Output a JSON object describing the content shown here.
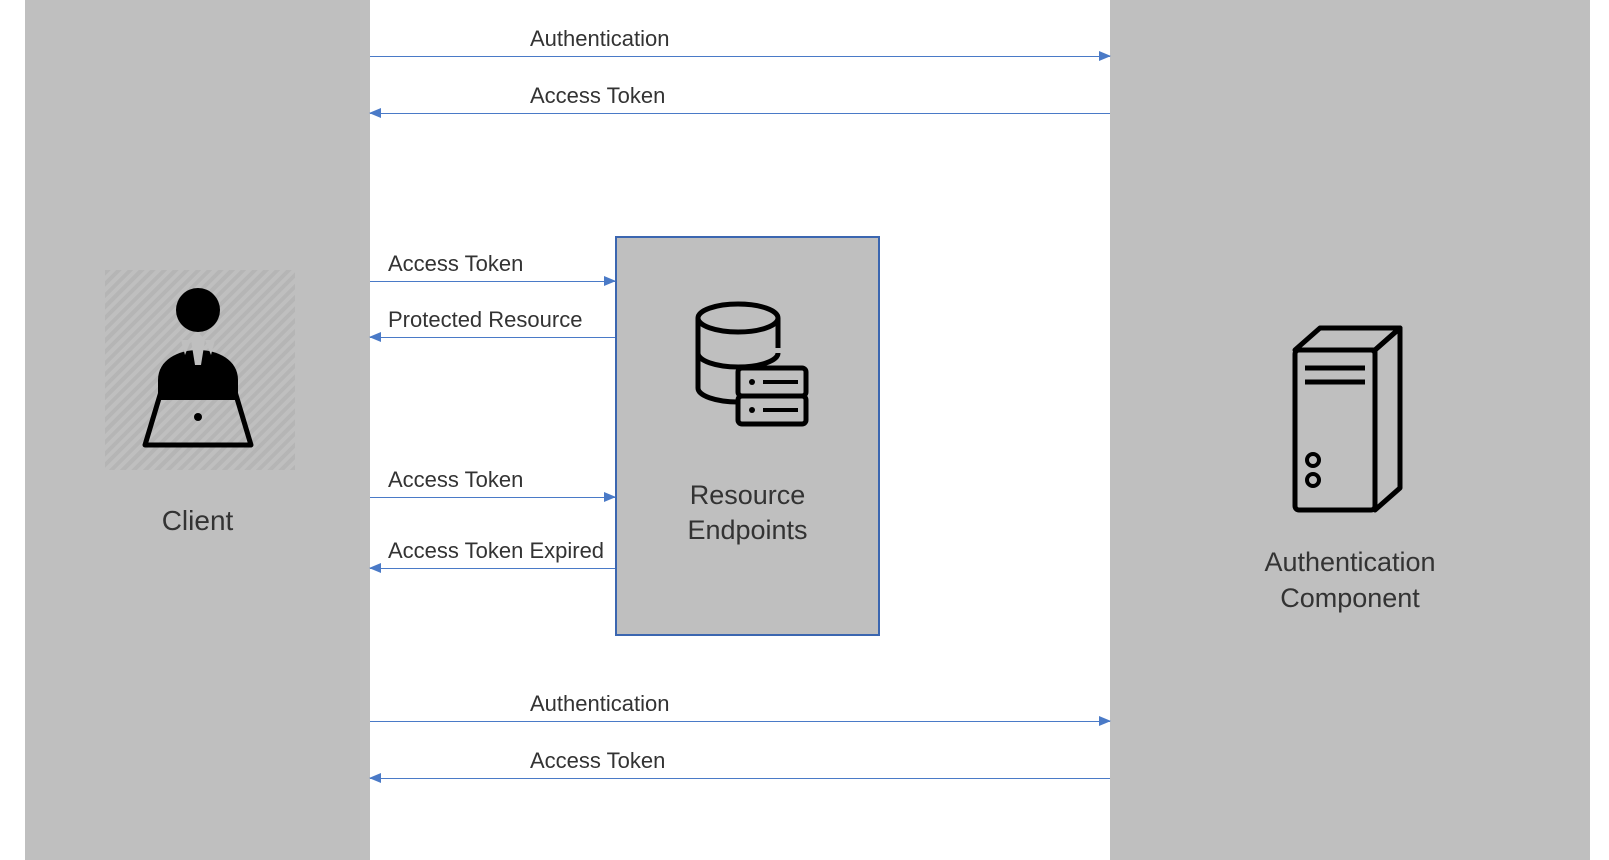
{
  "nodes": {
    "client": {
      "label": "Client"
    },
    "resource": {
      "label_line1": "Resource",
      "label_line2": "Endpoints"
    },
    "auth": {
      "label_line1": "Authentication",
      "label_line2": "Component"
    }
  },
  "arrows": {
    "a1": {
      "label": "Authentication"
    },
    "a2": {
      "label": "Access Token"
    },
    "a3": {
      "label": "Access Token"
    },
    "a4": {
      "label": "Protected Resource"
    },
    "a5": {
      "label": "Access Token"
    },
    "a6": {
      "label": "Access Token Expired"
    },
    "a7": {
      "label": "Authentication"
    },
    "a8": {
      "label": "Access Token"
    }
  },
  "icons": {
    "client": "person-laptop-icon",
    "resource": "database-server-icon",
    "auth": "server-tower-icon"
  },
  "colors": {
    "box_fill": "#bfbfbf",
    "box_border": "#3b66b0",
    "arrow": "#4a7ac7"
  }
}
